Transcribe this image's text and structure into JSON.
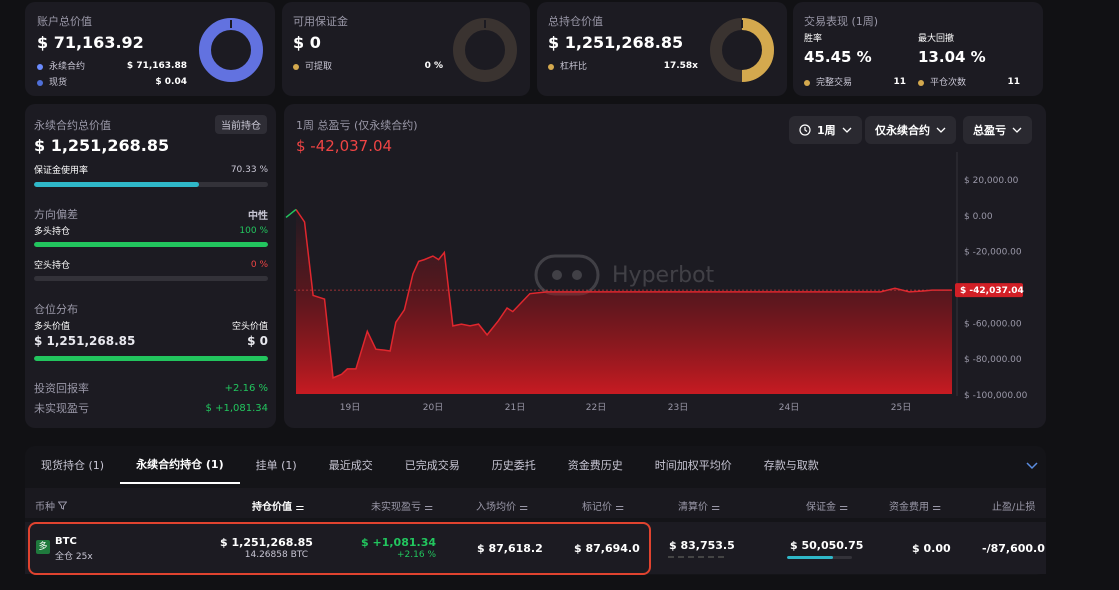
{
  "summary": {
    "account": {
      "title": "账户总价值",
      "value": "$ 71,163.92",
      "items": [
        {
          "label": "永续合约",
          "value": "$ 71,163.88"
        },
        {
          "label": "现货",
          "value": "$ 0.04"
        }
      ]
    },
    "margin": {
      "title": "可用保证金",
      "value": "$ 0",
      "items": [
        {
          "label": "可提取",
          "value": "0 %"
        }
      ]
    },
    "holding": {
      "title": "总持仓价值",
      "value": "$ 1,251,268.85",
      "items": [
        {
          "label": "杠杆比",
          "value": "17.58x"
        }
      ]
    },
    "performance": {
      "title": "交易表现 (1周)",
      "winrate_label": "胜率",
      "winrate": "45.45 %",
      "drawdown_label": "最大回撤",
      "drawdown": "13.04 %",
      "items": [
        {
          "label": "完整交易",
          "value": "11"
        },
        {
          "label": "平仓次数",
          "value": "11"
        }
      ]
    }
  },
  "left_panel": {
    "title": "永续合约总价值",
    "badge": "当前持仓",
    "value": "$ 1,251,268.85",
    "margin_usage_label": "保证金使用率",
    "margin_usage": "70.33 %",
    "margin_usage_fraction": 0.7033,
    "direction_label": "方向偏差",
    "direction_value": "中性",
    "long_label": "多头持仓",
    "long_pct": "100 %",
    "long_fraction": 1.0,
    "short_label": "空头持仓",
    "short_pct": "0 %",
    "short_fraction": 0.0,
    "distribution_label": "仓位分布",
    "long_value_label": "多头价值",
    "short_value_label": "空头价值",
    "long_value": "$ 1,251,268.85",
    "short_value": "$ 0",
    "roi_label": "投资回报率",
    "roi": "+2.16 %",
    "unrealized_label": "未实现盈亏",
    "unrealized": "$ +1,081.34"
  },
  "pnl_chart_header": {
    "title": "1周 总盈亏 (仅永续合约)",
    "value": "$ -42,037.04",
    "period": "1周",
    "filter": "仅永续合约",
    "metric": "总盈亏",
    "watermark": "Hyperbot",
    "current_label": "$ -42,037.04"
  },
  "chart_data": {
    "type": "area",
    "x_ticks": [
      "19日",
      "20日",
      "21日",
      "22日",
      "23日",
      "24日",
      "25日"
    ],
    "y_ticks": [
      "$ 20,000.00",
      "$ 0.00",
      "$ -20,000.00",
      "$ -40,000.00",
      "$ -60,000.00",
      "$ -80,000.00",
      "$ -100,000.00"
    ],
    "ylim": [
      -100000,
      20000
    ],
    "x": [
      0,
      0.3,
      0.6,
      1.0,
      1.3,
      1.6,
      1.8,
      2.1,
      2.5,
      2.8,
      3.1,
      3.3,
      3.5,
      3.8,
      4.1,
      4.3,
      4.5,
      4.8,
      5.0,
      5.2,
      5.5,
      5.8,
      6.1,
      6.4,
      6.7,
      7.1,
      7.4,
      7.6,
      7.9,
      8.2,
      8.5,
      8.8,
      9.0,
      9.5,
      10,
      11,
      12,
      13,
      14,
      15,
      16,
      17,
      18,
      19,
      20,
      20.5,
      21,
      21.5,
      22,
      22.3,
      22.7,
      23
    ],
    "y": [
      3000,
      -4000,
      -45000,
      -47000,
      -91000,
      -89000,
      -86000,
      -86000,
      -65000,
      -75000,
      -75500,
      -76000,
      -60000,
      -53000,
      -33000,
      -26000,
      -25000,
      -23000,
      -25000,
      -21000,
      -62000,
      -61000,
      -62000,
      -61000,
      -67000,
      -59000,
      -52000,
      -54000,
      -49000,
      -44000,
      -43500,
      -43000,
      -43000,
      -43000,
      -43000,
      -43000,
      -43000,
      -43000,
      -43000,
      -43000,
      -43000,
      -43000,
      -43000,
      -43000,
      -43000,
      -43000,
      -41000,
      -43000,
      -42500,
      -42000,
      -42037,
      -42037
    ],
    "current_value": -42037.04
  },
  "tabs": [
    "现货持仓 (1)",
    "永续合约持仓 (1)",
    "挂单 (1)",
    "最近成交",
    "已完成交易",
    "历史委托",
    "资金费历史",
    "时间加权平均价",
    "存款与取款"
  ],
  "table": {
    "headers": [
      "币种",
      "持仓价值",
      "未实现盈亏",
      "入场均价",
      "标记价",
      "清算价",
      "保证金",
      "资金费用",
      "止盈/止损"
    ],
    "row": {
      "coin": "BTC",
      "badge": "多",
      "mode": "全仓 25x",
      "value": "$ 1,251,268.85",
      "size": "14.26858 BTC",
      "pnl": "+1,081.34",
      "pnl_pct": "+2.16 %",
      "entry": "$ 87,618.2",
      "mark": "$ 87,694.0",
      "liq": "$ 83,753.5",
      "margin": "$ 50,050.75",
      "funding": "$ 0.00",
      "tpsl": "-/87,600.0"
    }
  }
}
